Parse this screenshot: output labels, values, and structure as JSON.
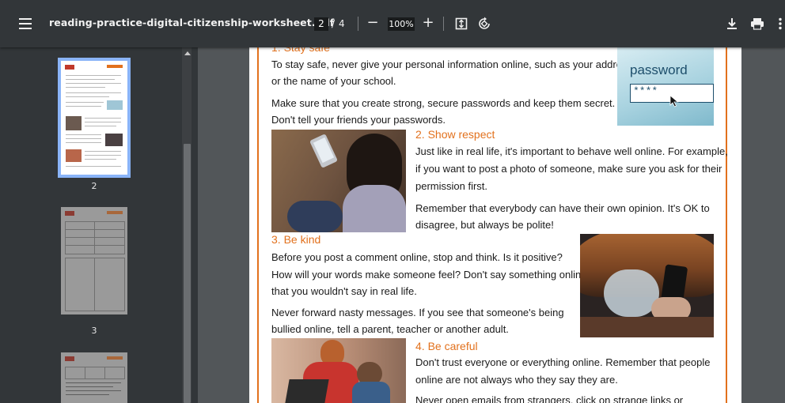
{
  "toolbar": {
    "filename": "reading-practice-digital-citizenship-worksheet.pdf",
    "current_page": "2",
    "page_separator": "/",
    "total_pages": "4",
    "zoom": "100%",
    "zoom_out": "−",
    "zoom_in": "+"
  },
  "sidebar": {
    "thumbnails": [
      {
        "label": "2"
      },
      {
        "label": "3"
      }
    ]
  },
  "page": {
    "sections": [
      {
        "heading": "1. Stay safe",
        "lines": [
          "To stay safe, never give your personal information online, such as your address",
          "or the name of your school.",
          "Make sure that you create strong, secure passwords and keep them secret.",
          "Don't tell your friends your passwords."
        ]
      },
      {
        "heading": "2. Show respect",
        "lines": [
          "Just like in real life, it's important to behave well online. For example,",
          "if you want to post a photo of someone, make sure you ask for their",
          "permission first.",
          "Remember that everybody can have their own opinion. It's OK to",
          "disagree, but always be polite!"
        ]
      },
      {
        "heading": "3. Be kind",
        "lines": [
          "Before you post a comment online, stop and think. Is it positive?",
          "How will your words make someone feel? Don't say something online",
          "that you wouldn't say in real life.",
          "Never forward nasty messages. If you see that someone's being",
          "bullied online, tell a parent, teacher or another adult."
        ]
      },
      {
        "heading": "4. Be careful",
        "lines": [
          "Don't trust everyone or everything online. Remember that people",
          "online are not always who they say they are.",
          "Never open emails from strangers, click on strange links or"
        ]
      }
    ],
    "password_image": {
      "label": "password",
      "masked": "****"
    }
  }
}
